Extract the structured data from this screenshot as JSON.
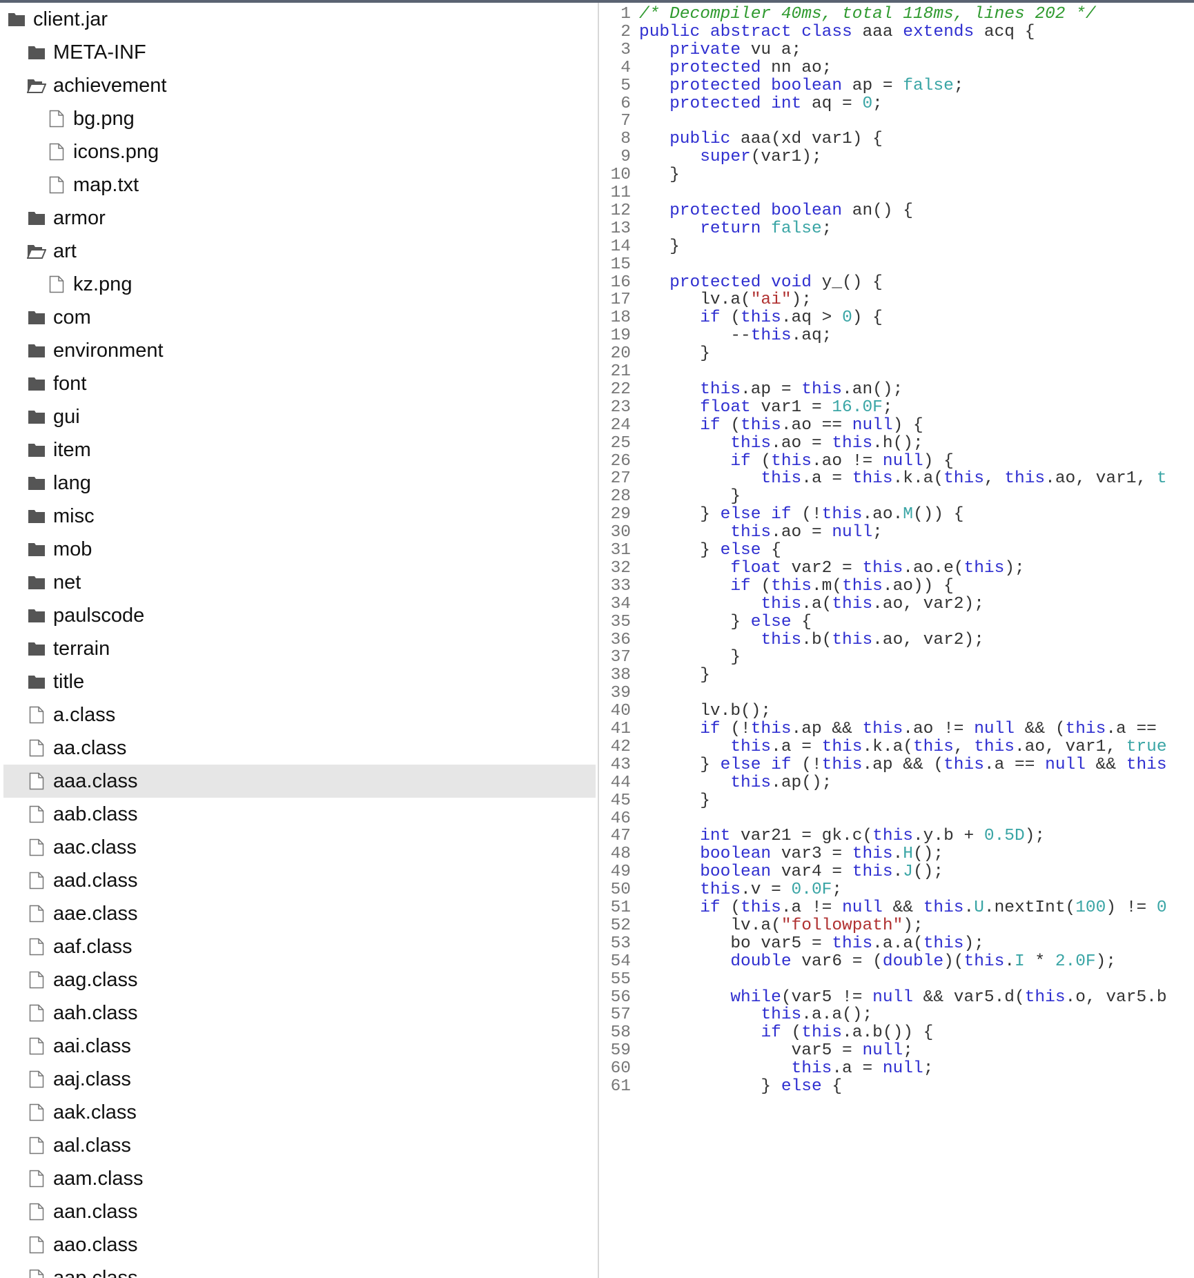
{
  "tree": {
    "items": [
      {
        "label": "client.jar",
        "type": "folder",
        "depth": 0
      },
      {
        "label": "META-INF",
        "type": "folder",
        "depth": 1
      },
      {
        "label": "achievement",
        "type": "folder-open",
        "depth": 1
      },
      {
        "label": "bg.png",
        "type": "file",
        "depth": 2
      },
      {
        "label": "icons.png",
        "type": "file",
        "depth": 2
      },
      {
        "label": "map.txt",
        "type": "file",
        "depth": 2
      },
      {
        "label": "armor",
        "type": "folder",
        "depth": 1
      },
      {
        "label": "art",
        "type": "folder-open",
        "depth": 1
      },
      {
        "label": "kz.png",
        "type": "file",
        "depth": 2
      },
      {
        "label": "com",
        "type": "folder",
        "depth": 1
      },
      {
        "label": "environment",
        "type": "folder",
        "depth": 1
      },
      {
        "label": "font",
        "type": "folder",
        "depth": 1
      },
      {
        "label": "gui",
        "type": "folder",
        "depth": 1
      },
      {
        "label": "item",
        "type": "folder",
        "depth": 1
      },
      {
        "label": "lang",
        "type": "folder",
        "depth": 1
      },
      {
        "label": "misc",
        "type": "folder",
        "depth": 1
      },
      {
        "label": "mob",
        "type": "folder",
        "depth": 1
      },
      {
        "label": "net",
        "type": "folder",
        "depth": 1
      },
      {
        "label": "paulscode",
        "type": "folder",
        "depth": 1
      },
      {
        "label": "terrain",
        "type": "folder",
        "depth": 1
      },
      {
        "label": "title",
        "type": "folder",
        "depth": 1
      },
      {
        "label": "a.class",
        "type": "file",
        "depth": 1
      },
      {
        "label": "aa.class",
        "type": "file",
        "depth": 1
      },
      {
        "label": "aaa.class",
        "type": "file",
        "depth": 1,
        "selected": true
      },
      {
        "label": "aab.class",
        "type": "file",
        "depth": 1
      },
      {
        "label": "aac.class",
        "type": "file",
        "depth": 1
      },
      {
        "label": "aad.class",
        "type": "file",
        "depth": 1
      },
      {
        "label": "aae.class",
        "type": "file",
        "depth": 1
      },
      {
        "label": "aaf.class",
        "type": "file",
        "depth": 1
      },
      {
        "label": "aag.class",
        "type": "file",
        "depth": 1
      },
      {
        "label": "aah.class",
        "type": "file",
        "depth": 1
      },
      {
        "label": "aai.class",
        "type": "file",
        "depth": 1
      },
      {
        "label": "aaj.class",
        "type": "file",
        "depth": 1
      },
      {
        "label": "aak.class",
        "type": "file",
        "depth": 1
      },
      {
        "label": "aal.class",
        "type": "file",
        "depth": 1
      },
      {
        "label": "aam.class",
        "type": "file",
        "depth": 1
      },
      {
        "label": "aan.class",
        "type": "file",
        "depth": 1
      },
      {
        "label": "aao.class",
        "type": "file",
        "depth": 1
      },
      {
        "label": "aap.class",
        "type": "file",
        "depth": 1
      }
    ]
  },
  "colors": {
    "keyword": "#2f2fd0",
    "number": "#3aa5a5",
    "string": "#b03030",
    "comment": "#2f9a2f",
    "plain": "#333333",
    "line_number": "#777777",
    "selected_row": "#e6e6e6",
    "folder_icon": "#555555"
  },
  "editor": {
    "lines": [
      [
        [
          "c",
          "/* Decompiler 40ms, total 118ms, lines 202 */"
        ]
      ],
      [
        [
          "k",
          "public abstract class "
        ],
        [
          "p",
          "aaa "
        ],
        [
          "k",
          "extends "
        ],
        [
          "p",
          "acq {"
        ]
      ],
      [
        [
          "p",
          "   "
        ],
        [
          "k",
          "private "
        ],
        [
          "p",
          "vu a;"
        ]
      ],
      [
        [
          "p",
          "   "
        ],
        [
          "k",
          "protected "
        ],
        [
          "p",
          "nn ao;"
        ]
      ],
      [
        [
          "p",
          "   "
        ],
        [
          "k",
          "protected boolean "
        ],
        [
          "p",
          "ap = "
        ],
        [
          "n",
          "false"
        ],
        [
          "p",
          ";"
        ]
      ],
      [
        [
          "p",
          "   "
        ],
        [
          "k",
          "protected int "
        ],
        [
          "p",
          "aq = "
        ],
        [
          "n",
          "0"
        ],
        [
          "p",
          ";"
        ]
      ],
      [],
      [
        [
          "p",
          "   "
        ],
        [
          "k",
          "public "
        ],
        [
          "p",
          "aaa(xd var1) {"
        ]
      ],
      [
        [
          "p",
          "      "
        ],
        [
          "k",
          "super"
        ],
        [
          "p",
          "(var1);"
        ]
      ],
      [
        [
          "p",
          "   }"
        ]
      ],
      [],
      [
        [
          "p",
          "   "
        ],
        [
          "k",
          "protected boolean "
        ],
        [
          "p",
          "an() {"
        ]
      ],
      [
        [
          "p",
          "      "
        ],
        [
          "k",
          "return "
        ],
        [
          "n",
          "false"
        ],
        [
          "p",
          ";"
        ]
      ],
      [
        [
          "p",
          "   }"
        ]
      ],
      [],
      [
        [
          "p",
          "   "
        ],
        [
          "k",
          "protected void "
        ],
        [
          "p",
          "y_() {"
        ]
      ],
      [
        [
          "p",
          "      lv.a("
        ],
        [
          "s",
          "\"ai\""
        ],
        [
          "p",
          ");"
        ]
      ],
      [
        [
          "p",
          "      "
        ],
        [
          "k",
          "if "
        ],
        [
          "p",
          "("
        ],
        [
          "k",
          "this"
        ],
        [
          "p",
          ".aq > "
        ],
        [
          "n",
          "0"
        ],
        [
          "p",
          ") {"
        ]
      ],
      [
        [
          "p",
          "         --"
        ],
        [
          "k",
          "this"
        ],
        [
          "p",
          ".aq;"
        ]
      ],
      [
        [
          "p",
          "      }"
        ]
      ],
      [],
      [
        [
          "p",
          "      "
        ],
        [
          "k",
          "this"
        ],
        [
          "p",
          ".ap = "
        ],
        [
          "k",
          "this"
        ],
        [
          "p",
          ".an();"
        ]
      ],
      [
        [
          "p",
          "      "
        ],
        [
          "k",
          "float "
        ],
        [
          "p",
          "var1 = "
        ],
        [
          "n",
          "16.0F"
        ],
        [
          "p",
          ";"
        ]
      ],
      [
        [
          "p",
          "      "
        ],
        [
          "k",
          "if "
        ],
        [
          "p",
          "("
        ],
        [
          "k",
          "this"
        ],
        [
          "p",
          ".ao == "
        ],
        [
          "k",
          "null"
        ],
        [
          "p",
          ") {"
        ]
      ],
      [
        [
          "p",
          "         "
        ],
        [
          "k",
          "this"
        ],
        [
          "p",
          ".ao = "
        ],
        [
          "k",
          "this"
        ],
        [
          "p",
          ".h();"
        ]
      ],
      [
        [
          "p",
          "         "
        ],
        [
          "k",
          "if "
        ],
        [
          "p",
          "("
        ],
        [
          "k",
          "this"
        ],
        [
          "p",
          ".ao != "
        ],
        [
          "k",
          "null"
        ],
        [
          "p",
          ") {"
        ]
      ],
      [
        [
          "p",
          "            "
        ],
        [
          "k",
          "this"
        ],
        [
          "p",
          ".a = "
        ],
        [
          "k",
          "this"
        ],
        [
          "p",
          ".k.a("
        ],
        [
          "k",
          "this"
        ],
        [
          "p",
          ", "
        ],
        [
          "k",
          "this"
        ],
        [
          "p",
          ".ao, var1, "
        ],
        [
          "n",
          "t"
        ]
      ],
      [
        [
          "p",
          "         }"
        ]
      ],
      [
        [
          "p",
          "      } "
        ],
        [
          "k",
          "else if "
        ],
        [
          "p",
          "(!"
        ],
        [
          "k",
          "this"
        ],
        [
          "p",
          ".ao."
        ],
        [
          "n",
          "M"
        ],
        [
          "p",
          "()) {"
        ]
      ],
      [
        [
          "p",
          "         "
        ],
        [
          "k",
          "this"
        ],
        [
          "p",
          ".ao = "
        ],
        [
          "k",
          "null"
        ],
        [
          "p",
          ";"
        ]
      ],
      [
        [
          "p",
          "      } "
        ],
        [
          "k",
          "else "
        ],
        [
          "p",
          "{"
        ]
      ],
      [
        [
          "p",
          "         "
        ],
        [
          "k",
          "float "
        ],
        [
          "p",
          "var2 = "
        ],
        [
          "k",
          "this"
        ],
        [
          "p",
          ".ao.e("
        ],
        [
          "k",
          "this"
        ],
        [
          "p",
          ");"
        ]
      ],
      [
        [
          "p",
          "         "
        ],
        [
          "k",
          "if "
        ],
        [
          "p",
          "("
        ],
        [
          "k",
          "this"
        ],
        [
          "p",
          ".m("
        ],
        [
          "k",
          "this"
        ],
        [
          "p",
          ".ao)) {"
        ]
      ],
      [
        [
          "p",
          "            "
        ],
        [
          "k",
          "this"
        ],
        [
          "p",
          ".a("
        ],
        [
          "k",
          "this"
        ],
        [
          "p",
          ".ao, var2);"
        ]
      ],
      [
        [
          "p",
          "         } "
        ],
        [
          "k",
          "else "
        ],
        [
          "p",
          "{"
        ]
      ],
      [
        [
          "p",
          "            "
        ],
        [
          "k",
          "this"
        ],
        [
          "p",
          ".b("
        ],
        [
          "k",
          "this"
        ],
        [
          "p",
          ".ao, var2);"
        ]
      ],
      [
        [
          "p",
          "         }"
        ]
      ],
      [
        [
          "p",
          "      }"
        ]
      ],
      [],
      [
        [
          "p",
          "      lv.b();"
        ]
      ],
      [
        [
          "p",
          "      "
        ],
        [
          "k",
          "if "
        ],
        [
          "p",
          "(!"
        ],
        [
          "k",
          "this"
        ],
        [
          "p",
          ".ap && "
        ],
        [
          "k",
          "this"
        ],
        [
          "p",
          ".ao != "
        ],
        [
          "k",
          "null"
        ],
        [
          "p",
          " && ("
        ],
        [
          "k",
          "this"
        ],
        [
          "p",
          ".a =="
        ]
      ],
      [
        [
          "p",
          "         "
        ],
        [
          "k",
          "this"
        ],
        [
          "p",
          ".a = "
        ],
        [
          "k",
          "this"
        ],
        [
          "p",
          ".k.a("
        ],
        [
          "k",
          "this"
        ],
        [
          "p",
          ", "
        ],
        [
          "k",
          "this"
        ],
        [
          "p",
          ".ao, var1, "
        ],
        [
          "n",
          "true"
        ]
      ],
      [
        [
          "p",
          "      } "
        ],
        [
          "k",
          "else if "
        ],
        [
          "p",
          "(!"
        ],
        [
          "k",
          "this"
        ],
        [
          "p",
          ".ap && ("
        ],
        [
          "k",
          "this"
        ],
        [
          "p",
          ".a == "
        ],
        [
          "k",
          "null"
        ],
        [
          "p",
          " && "
        ],
        [
          "k",
          "this"
        ]
      ],
      [
        [
          "p",
          "         "
        ],
        [
          "k",
          "this"
        ],
        [
          "p",
          ".ap();"
        ]
      ],
      [
        [
          "p",
          "      }"
        ]
      ],
      [],
      [
        [
          "p",
          "      "
        ],
        [
          "k",
          "int "
        ],
        [
          "p",
          "var21 = gk.c("
        ],
        [
          "k",
          "this"
        ],
        [
          "p",
          ".y.b + "
        ],
        [
          "n",
          "0.5D"
        ],
        [
          "p",
          ");"
        ]
      ],
      [
        [
          "p",
          "      "
        ],
        [
          "k",
          "boolean "
        ],
        [
          "p",
          "var3 = "
        ],
        [
          "k",
          "this"
        ],
        [
          "p",
          "."
        ],
        [
          "n",
          "H"
        ],
        [
          "p",
          "();"
        ]
      ],
      [
        [
          "p",
          "      "
        ],
        [
          "k",
          "boolean "
        ],
        [
          "p",
          "var4 = "
        ],
        [
          "k",
          "this"
        ],
        [
          "p",
          "."
        ],
        [
          "n",
          "J"
        ],
        [
          "p",
          "();"
        ]
      ],
      [
        [
          "p",
          "      "
        ],
        [
          "k",
          "this"
        ],
        [
          "p",
          ".v = "
        ],
        [
          "n",
          "0.0F"
        ],
        [
          "p",
          ";"
        ]
      ],
      [
        [
          "p",
          "      "
        ],
        [
          "k",
          "if "
        ],
        [
          "p",
          "("
        ],
        [
          "k",
          "this"
        ],
        [
          "p",
          ".a != "
        ],
        [
          "k",
          "null"
        ],
        [
          "p",
          " && "
        ],
        [
          "k",
          "this"
        ],
        [
          "p",
          "."
        ],
        [
          "n",
          "U"
        ],
        [
          "p",
          ".nextInt("
        ],
        [
          "n",
          "100"
        ],
        [
          "p",
          ") != "
        ],
        [
          "n",
          "0"
        ]
      ],
      [
        [
          "p",
          "         lv.a("
        ],
        [
          "s",
          "\"followpath\""
        ],
        [
          "p",
          ");"
        ]
      ],
      [
        [
          "p",
          "         bo var5 = "
        ],
        [
          "k",
          "this"
        ],
        [
          "p",
          ".a.a("
        ],
        [
          "k",
          "this"
        ],
        [
          "p",
          ");"
        ]
      ],
      [
        [
          "p",
          "         "
        ],
        [
          "k",
          "double "
        ],
        [
          "p",
          "var6 = ("
        ],
        [
          "k",
          "double"
        ],
        [
          "p",
          ")("
        ],
        [
          "k",
          "this"
        ],
        [
          "p",
          "."
        ],
        [
          "n",
          "I"
        ],
        [
          "p",
          " * "
        ],
        [
          "n",
          "2.0F"
        ],
        [
          "p",
          ");"
        ]
      ],
      [],
      [
        [
          "p",
          "         "
        ],
        [
          "k",
          "while"
        ],
        [
          "p",
          "(var5 != "
        ],
        [
          "k",
          "null"
        ],
        [
          "p",
          " && var5.d("
        ],
        [
          "k",
          "this"
        ],
        [
          "p",
          ".o, var5.b"
        ]
      ],
      [
        [
          "p",
          "            "
        ],
        [
          "k",
          "this"
        ],
        [
          "p",
          ".a.a();"
        ]
      ],
      [
        [
          "p",
          "            "
        ],
        [
          "k",
          "if "
        ],
        [
          "p",
          "("
        ],
        [
          "k",
          "this"
        ],
        [
          "p",
          ".a.b()) {"
        ]
      ],
      [
        [
          "p",
          "               var5 = "
        ],
        [
          "k",
          "null"
        ],
        [
          "p",
          ";"
        ]
      ],
      [
        [
          "p",
          "               "
        ],
        [
          "k",
          "this"
        ],
        [
          "p",
          ".a = "
        ],
        [
          "k",
          "null"
        ],
        [
          "p",
          ";"
        ]
      ],
      [
        [
          "p",
          "            } "
        ],
        [
          "k",
          "else "
        ],
        [
          "p",
          "{"
        ]
      ]
    ]
  }
}
